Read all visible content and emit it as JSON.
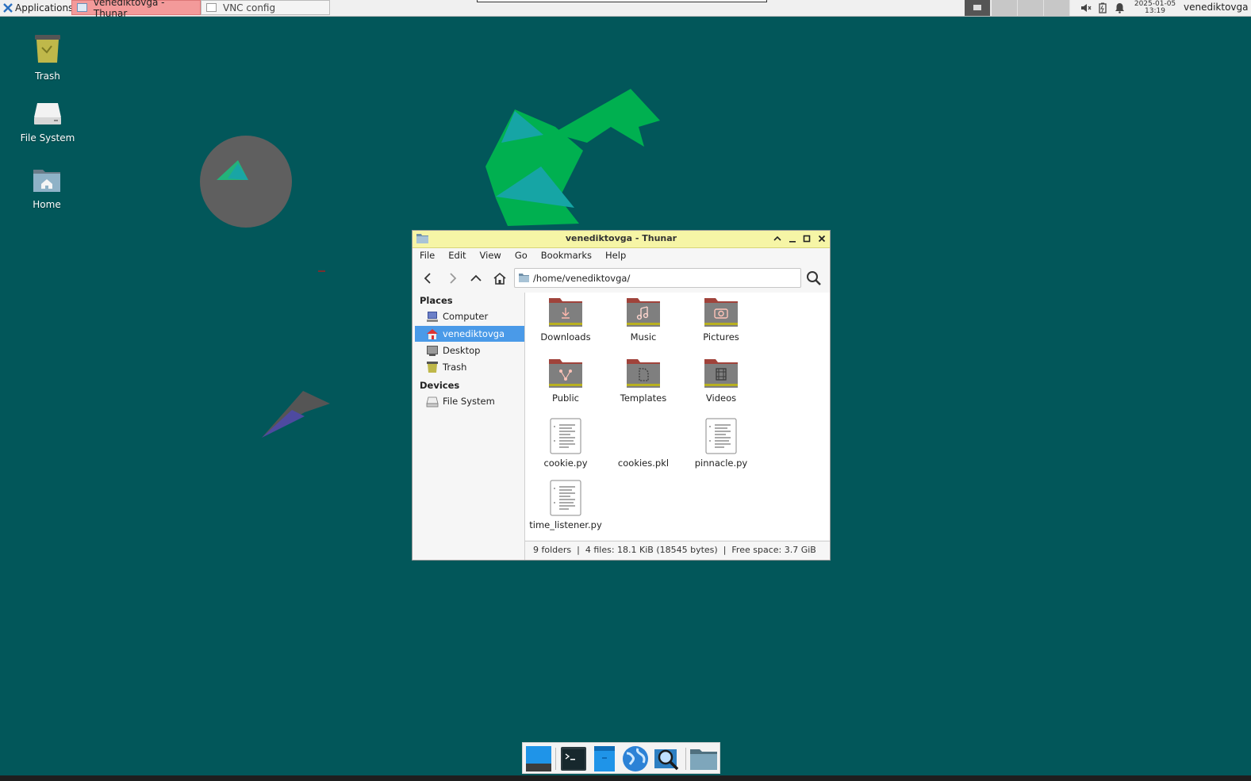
{
  "top_panel": {
    "apps_label": "Applications :",
    "tasks": [
      {
        "label": "venediktovga - Thunar"
      },
      {
        "label": "VNC config"
      }
    ],
    "clock_date": "2025-01-05",
    "clock_time": "13:19",
    "user": "venediktovga"
  },
  "desktop": {
    "icons": [
      {
        "label": "Trash",
        "icon": "trash-icon"
      },
      {
        "label": "File System",
        "icon": "drive-icon"
      },
      {
        "label": "Home",
        "icon": "home-folder-icon"
      }
    ]
  },
  "thunar": {
    "title": "venediktovga - Thunar",
    "menu": [
      "File",
      "Edit",
      "View",
      "Go",
      "Bookmarks",
      "Help"
    ],
    "location": "/home/venediktovga/",
    "sidebar": {
      "places_heading": "Places",
      "places": [
        {
          "label": "Computer",
          "icon": "computer-icon"
        },
        {
          "label": "venediktovga",
          "icon": "home-icon",
          "selected": true
        },
        {
          "label": "Desktop",
          "icon": "desktop-icon"
        },
        {
          "label": "Trash",
          "icon": "trash-icon"
        }
      ],
      "devices_heading": "Devices",
      "devices": [
        {
          "label": "File System",
          "icon": "drive-icon"
        }
      ]
    },
    "files": [
      {
        "name": "Downloads",
        "icon": "folder-downloads-icon"
      },
      {
        "name": "Music",
        "icon": "folder-music-icon"
      },
      {
        "name": "Pictures",
        "icon": "folder-pictures-icon"
      },
      {
        "name": "Public",
        "icon": "folder-public-icon"
      },
      {
        "name": "Templates",
        "icon": "folder-templates-icon"
      },
      {
        "name": "Videos",
        "icon": "folder-videos-icon"
      },
      {
        "name": "cookie.py",
        "icon": "text-file-icon"
      },
      {
        "name": "cookies.pkl",
        "icon": "blank"
      },
      {
        "name": "pinnacle.py",
        "icon": "text-file-icon"
      },
      {
        "name": "time_listener.py",
        "icon": "text-file-icon"
      }
    ],
    "status": "9 folders  |  4 files: 18.1 KiB (18545 bytes)  |  Free space: 3.7 GiB"
  },
  "dock": {
    "apps": [
      "show-desktop-icon",
      "terminal-icon",
      "files-icon",
      "web-browser-icon",
      "search-icon",
      "folder-icon"
    ]
  },
  "colors": {
    "desktop_bg": "#02575a",
    "active_task": "#f39a9a",
    "title_bar": "#f6f5a6",
    "selection": "#4a9ae8"
  }
}
